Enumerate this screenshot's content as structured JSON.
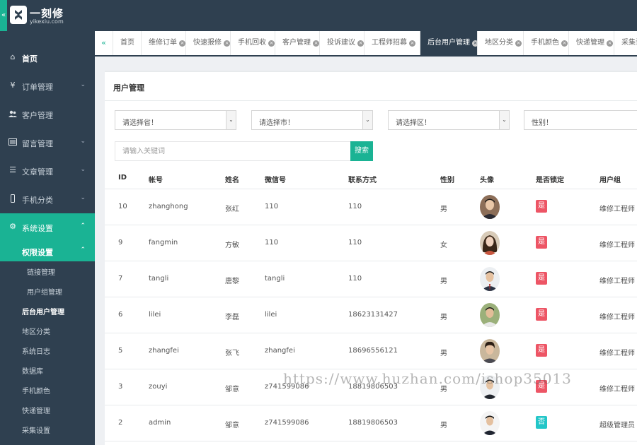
{
  "app": {
    "logo_text": "一刻修",
    "logo_sub": "yikexiu.com"
  },
  "sidebar": {
    "items": [
      {
        "label": "首页",
        "icon": "home-icon"
      },
      {
        "label": "订单管理",
        "icon": "yen-icon"
      },
      {
        "label": "客户管理",
        "icon": "users-icon"
      },
      {
        "label": "留言管理",
        "icon": "list-icon"
      },
      {
        "label": "文章管理",
        "icon": "list-alt-icon"
      },
      {
        "label": "手机分类",
        "icon": "mobile-icon"
      },
      {
        "label": "系统设置",
        "icon": "gear-icon"
      }
    ],
    "perm_group": "权限设置",
    "perm_children": [
      "链接管理",
      "用户组管理"
    ],
    "sys_children": [
      "后台用户管理",
      "地区分类",
      "系统日志",
      "数据库",
      "手机颜色",
      "快递管理",
      "采集设置"
    ]
  },
  "tabs": [
    "首页",
    "维修订单",
    "快速报修",
    "手机回收",
    "客户管理",
    "投诉建议",
    "工程师招募",
    "后台用户管理",
    "地区分类",
    "手机颜色",
    "快递管理",
    "采集设置"
  ],
  "panel": {
    "title": "用户管理",
    "filters": {
      "province": "请选择省！",
      "city": "请选择市！",
      "district": "请选择区！",
      "gender": "性别！"
    },
    "keyword_placeholder": "请输入关键词",
    "search_label": "搜索"
  },
  "table": {
    "columns": [
      "ID",
      "帐号",
      "姓名",
      "微信号",
      "联系方式",
      "性别",
      "头像",
      "是否锁定",
      "用户组"
    ],
    "rows": [
      {
        "id": "10",
        "account": "zhanghong",
        "name": "张红",
        "wechat": "110",
        "phone": "110",
        "gender": "男",
        "locked": "是",
        "group": "维修工程师"
      },
      {
        "id": "9",
        "account": "fangmin",
        "name": "方敏",
        "wechat": "110",
        "phone": "110",
        "gender": "女",
        "locked": "是",
        "group": "维修工程师"
      },
      {
        "id": "7",
        "account": "tangli",
        "name": "唐黎",
        "wechat": "tangli",
        "phone": "110",
        "gender": "男",
        "locked": "是",
        "group": "维修工程师"
      },
      {
        "id": "6",
        "account": "lilei",
        "name": "李磊",
        "wechat": "lilei",
        "phone": "18623131427",
        "gender": "男",
        "locked": "是",
        "group": "维修工程师"
      },
      {
        "id": "5",
        "account": "zhangfei",
        "name": "张飞",
        "wechat": "zhangfei",
        "phone": "18696556121",
        "gender": "男",
        "locked": "是",
        "group": "维修工程师"
      },
      {
        "id": "3",
        "account": "zouyi",
        "name": "邹意",
        "wechat": "z741599086",
        "phone": "18819806503",
        "gender": "男",
        "locked": "是",
        "group": "维修工程师"
      },
      {
        "id": "2",
        "account": "admin",
        "name": "邹意",
        "wechat": "z741599086",
        "phone": "18819806503",
        "gender": "男",
        "locked": "否",
        "group": "超级管理员"
      }
    ]
  },
  "watermark": "https://www.huzhan.com/ishop35013",
  "colors": {
    "sidebar_bg": "#2f4050",
    "accent": "#1ab394",
    "lock_yes": "#ed5565",
    "lock_no": "#23c6c8"
  }
}
